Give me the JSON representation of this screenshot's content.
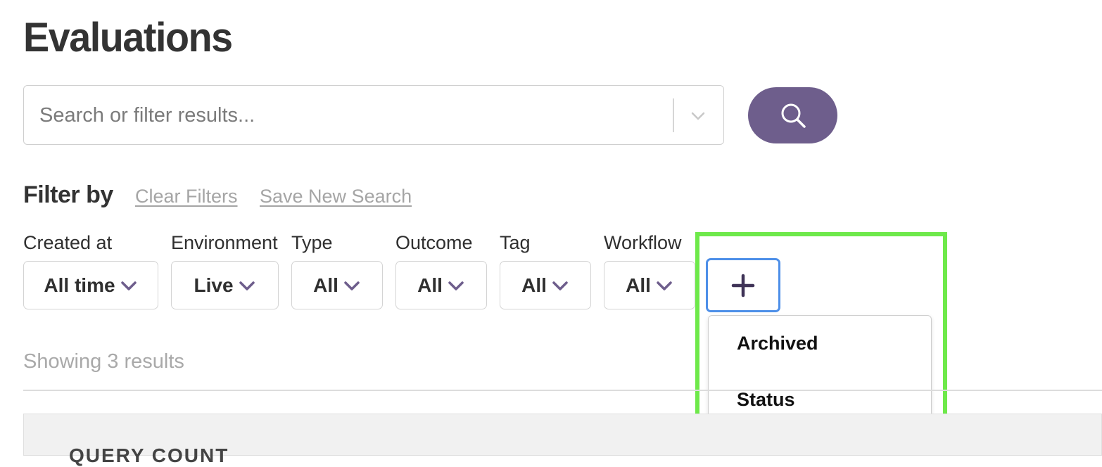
{
  "page": {
    "title": "Evaluations"
  },
  "search": {
    "placeholder": "Search or filter results..."
  },
  "filters": {
    "heading": "Filter by",
    "clear_label": "Clear Filters",
    "save_label": "Save New Search",
    "items": [
      {
        "label": "Created at",
        "value": "All time"
      },
      {
        "label": "Environment",
        "value": "Live"
      },
      {
        "label": "Type",
        "value": "All"
      },
      {
        "label": "Outcome",
        "value": "All"
      },
      {
        "label": "Tag",
        "value": "All"
      },
      {
        "label": "Workflow",
        "value": "All"
      }
    ],
    "add_button_icon": "plus-icon",
    "menu": {
      "items": [
        {
          "label": "Archived"
        },
        {
          "label": "Status"
        }
      ]
    }
  },
  "results": {
    "count_text": "Showing 3 results",
    "header_partial": "QUERY COUNT"
  },
  "colors": {
    "accent": "#6e5e8c",
    "chevron": "#6e5e8c",
    "focus_ring": "#4d8fe8",
    "highlight": "#6ee94a"
  }
}
